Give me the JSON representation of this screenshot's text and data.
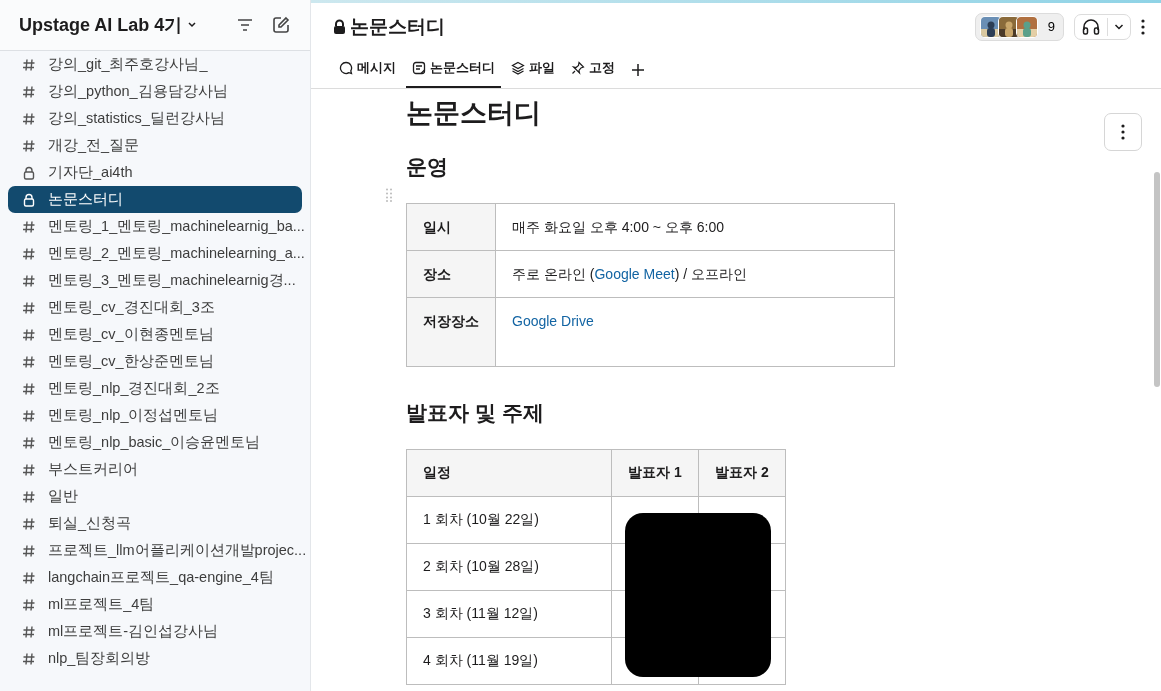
{
  "sidebar": {
    "workspace": "Upstage AI Lab 4기",
    "channels": [
      {
        "name": "강의_git_최주호강사님_",
        "kind": "public",
        "selected": false
      },
      {
        "name": "강의_python_김용담강사님",
        "kind": "public",
        "selected": false
      },
      {
        "name": "강의_statistics_딜런강사님",
        "kind": "public",
        "selected": false
      },
      {
        "name": "개강_전_질문",
        "kind": "public",
        "selected": false
      },
      {
        "name": "기자단_ai4th",
        "kind": "private",
        "selected": false
      },
      {
        "name": "논문스터디",
        "kind": "private",
        "selected": true
      },
      {
        "name": "멘토링_1_멘토링_machinelearnig_ba...",
        "kind": "public",
        "selected": false
      },
      {
        "name": "멘토링_2_멘토링_machinelearning_a...",
        "kind": "public",
        "selected": false
      },
      {
        "name": "멘토링_3_멘토링_machinelearnig경...",
        "kind": "public",
        "selected": false
      },
      {
        "name": "멘토링_cv_경진대회_3조",
        "kind": "public",
        "selected": false
      },
      {
        "name": "멘토링_cv_이현종멘토님",
        "kind": "public",
        "selected": false
      },
      {
        "name": "멘토링_cv_한상준멘토님",
        "kind": "public",
        "selected": false
      },
      {
        "name": "멘토링_nlp_경진대회_2조",
        "kind": "public",
        "selected": false
      },
      {
        "name": "멘토링_nlp_이정섭멘토님",
        "kind": "public",
        "selected": false
      },
      {
        "name": "멘토링_nlp_basic_이승윤멘토님",
        "kind": "public",
        "selected": false
      },
      {
        "name": "부스트커리어",
        "kind": "public",
        "selected": false
      },
      {
        "name": "일반",
        "kind": "public",
        "selected": false
      },
      {
        "name": "퇴실_신청곡",
        "kind": "public",
        "selected": false
      },
      {
        "name": "프로젝트_llm어플리케이션개발projec...",
        "kind": "public",
        "selected": false
      },
      {
        "name": "langchain프로젝트_qa-engine_4팀",
        "kind": "public",
        "selected": false
      },
      {
        "name": "ml프로젝트_4팀",
        "kind": "public",
        "selected": false
      },
      {
        "name": "ml프로젝트-김인섭강사님",
        "kind": "public",
        "selected": false
      },
      {
        "name": "nlp_팀장회의방",
        "kind": "public",
        "selected": false
      }
    ]
  },
  "header": {
    "channel": "논문스터디",
    "member_count": "9",
    "tabs": [
      {
        "label": "메시지",
        "selected": false
      },
      {
        "label": "논문스터디",
        "selected": true
      },
      {
        "label": "파일",
        "selected": false
      },
      {
        "label": "고정",
        "selected": false
      }
    ]
  },
  "document": {
    "title": "논문스터디",
    "section_1": {
      "heading": "운영",
      "rows": [
        {
          "label": "일시",
          "value": "매주 화요일 오후 4:00 ~ 오후 6:00",
          "links": []
        },
        {
          "label": "장소",
          "value": "주로 온라인 (",
          "links": [
            "Google Meet"
          ],
          "after": ") / 오프라인"
        },
        {
          "label": "저장장소",
          "value": "",
          "links": [
            "Google Drive"
          ]
        }
      ]
    },
    "section_2": {
      "heading": "발표자 및 주제",
      "columns": [
        "일정",
        "발표자 1",
        "발표자 2"
      ],
      "rows": [
        "1 회차 (10월 22일)",
        "2 회차 (10월 28일)",
        "3 회차 (11월 12일)",
        "4 회차 (11월 19일)"
      ]
    }
  }
}
